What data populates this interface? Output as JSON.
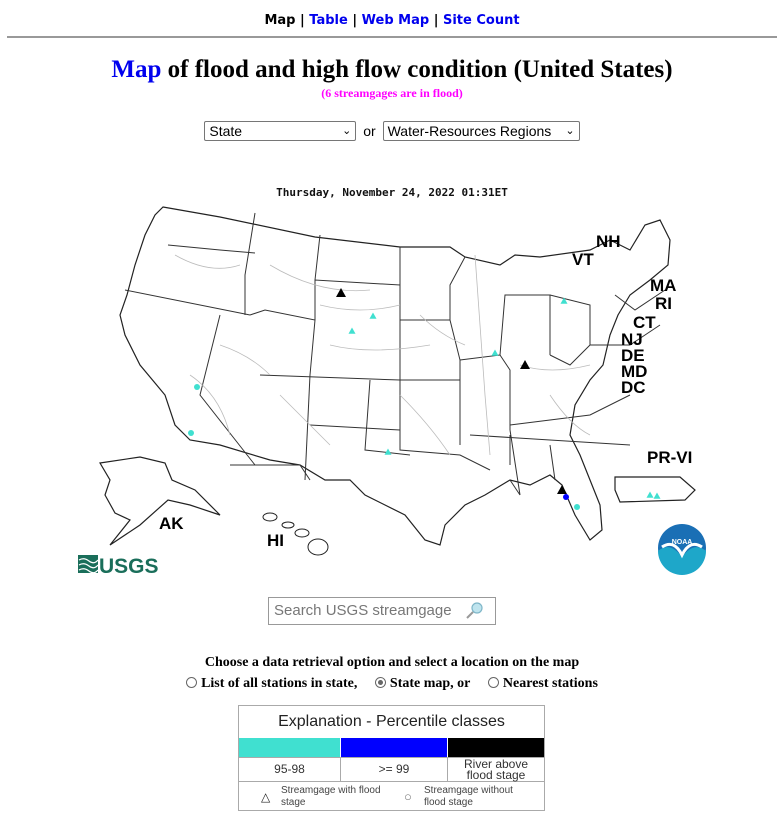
{
  "nav": {
    "items": [
      {
        "label": "Map",
        "current": true
      },
      {
        "label": "Table",
        "current": false
      },
      {
        "label": "Web Map",
        "current": false
      },
      {
        "label": "Site Count",
        "current": false
      }
    ],
    "separator": "|"
  },
  "header": {
    "title_link": "Map",
    "title_rest": " of flood and high flow condition (United States)",
    "subtitle": "(6 streamgages are in flood)"
  },
  "selectors": {
    "state_selected": "State",
    "or_label": "or",
    "region_selected": "Water-Resources Regions"
  },
  "map": {
    "datestamp": "Thursday, November 24, 2022 01:31ET",
    "state_labels": [
      "NH",
      "VT",
      "MA",
      "RI",
      "CT",
      "NJ",
      "DE",
      "MD",
      "DC",
      "PR-VI",
      "AK",
      "HI"
    ],
    "logos": {
      "usgs": "USGS",
      "noaa": "NOAA"
    },
    "colors": {
      "p95_98": "#40e0d0",
      "p99": "#0000ff",
      "flood": "#000000"
    },
    "gages": [
      {
        "state": "ND",
        "class": "flood",
        "shape": "triangle"
      },
      {
        "state": "NE",
        "class": "p95_98",
        "shape": "triangle"
      },
      {
        "state": "NE",
        "class": "p95_98",
        "shape": "triangle"
      },
      {
        "state": "KY",
        "class": "flood",
        "shape": "triangle"
      },
      {
        "state": "IN",
        "class": "p95_98",
        "shape": "triangle"
      },
      {
        "state": "TX",
        "class": "p95_98",
        "shape": "triangle"
      },
      {
        "state": "NY",
        "class": "p95_98",
        "shape": "triangle"
      },
      {
        "state": "NV",
        "class": "p95_98",
        "shape": "circle"
      },
      {
        "state": "AZ",
        "class": "p95_98",
        "shape": "circle"
      },
      {
        "state": "FL",
        "class": "flood",
        "shape": "triangle"
      },
      {
        "state": "FL",
        "class": "p99",
        "shape": "circle"
      },
      {
        "state": "FL",
        "class": "p95_98",
        "shape": "circle"
      },
      {
        "state": "PR",
        "class": "p95_98",
        "shape": "triangle"
      },
      {
        "state": "PR",
        "class": "p95_98",
        "shape": "triangle"
      }
    ]
  },
  "search": {
    "placeholder": "Search USGS streamgage"
  },
  "retrieval": {
    "prompt": "Choose a data retrieval option and select a location on the map",
    "options": [
      {
        "label": "List of all stations in state,",
        "selected": false
      },
      {
        "label": "State map, or",
        "selected": true
      },
      {
        "label": "Nearest stations",
        "selected": false
      }
    ]
  },
  "legend": {
    "title": "Explanation - Percentile classes",
    "classes": [
      {
        "label": "95-98",
        "color": "#40e0d0"
      },
      {
        "label": ">= 99",
        "color": "#0000ff"
      },
      {
        "label": "River above flood stage",
        "color": "#000000"
      }
    ],
    "symbols": [
      {
        "label": "Streamgage with flood stage",
        "icon": "triangle"
      },
      {
        "label": "Streamgage without flood stage",
        "icon": "circle"
      }
    ]
  }
}
